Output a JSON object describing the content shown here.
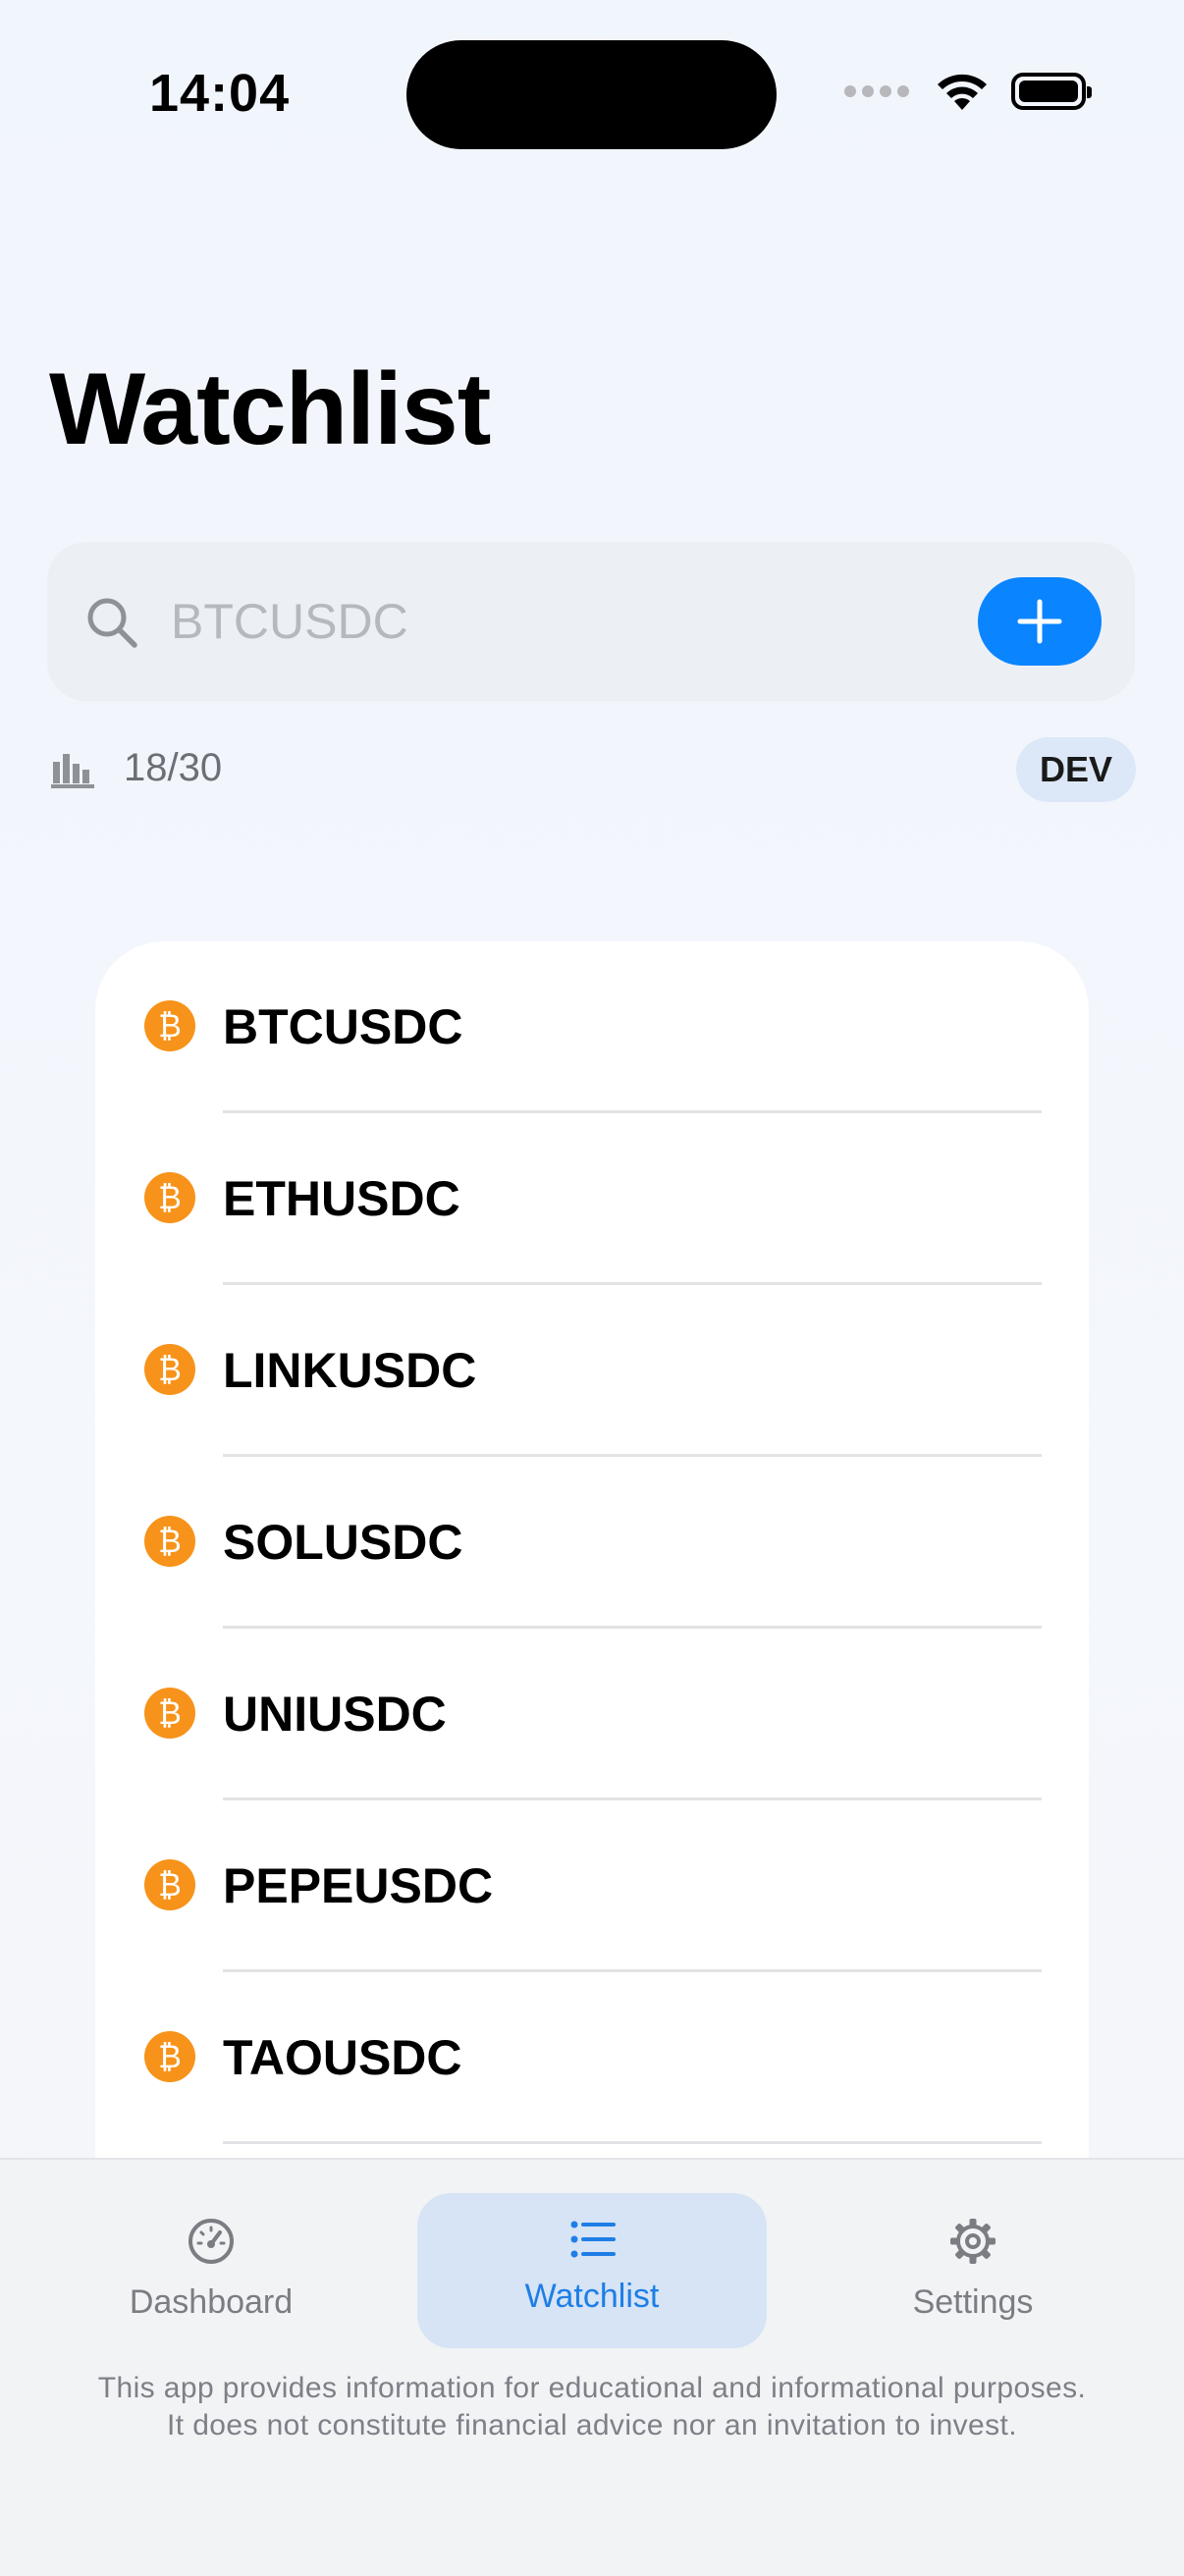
{
  "status_bar": {
    "time": "14:04"
  },
  "page": {
    "title": "Watchlist"
  },
  "search": {
    "placeholder": "BTCUSDC",
    "value": ""
  },
  "usage": {
    "count": "18/30",
    "badge": "DEV"
  },
  "watchlist": {
    "items": [
      {
        "symbol": "BTCUSDC",
        "icon_glyph": "₿"
      },
      {
        "symbol": "ETHUSDC",
        "icon_glyph": "₿"
      },
      {
        "symbol": "LINKUSDC",
        "icon_glyph": "₿"
      },
      {
        "symbol": "SOLUSDC",
        "icon_glyph": "₿"
      },
      {
        "symbol": "UNIUSDC",
        "icon_glyph": "₿"
      },
      {
        "symbol": "PEPEUSDC",
        "icon_glyph": "₿"
      },
      {
        "symbol": "TAOUSDC",
        "icon_glyph": "₿"
      }
    ]
  },
  "tabs": [
    {
      "label": "Dashboard",
      "icon": "gauge-icon",
      "selected": false
    },
    {
      "label": "Watchlist",
      "icon": "list-icon",
      "selected": true
    },
    {
      "label": "Settings",
      "icon": "gear-icon",
      "selected": false
    }
  ],
  "disclaimer": {
    "line1": "This app provides information for educational and informational purposes.",
    "line2": "It does not constitute financial advice nor an invitation to invest."
  },
  "colors": {
    "accent": "#0a84ff",
    "coin": "#f7931a",
    "tab_selected_bg": "#d6e4f5",
    "tab_selected_text": "#1e7ee6"
  }
}
